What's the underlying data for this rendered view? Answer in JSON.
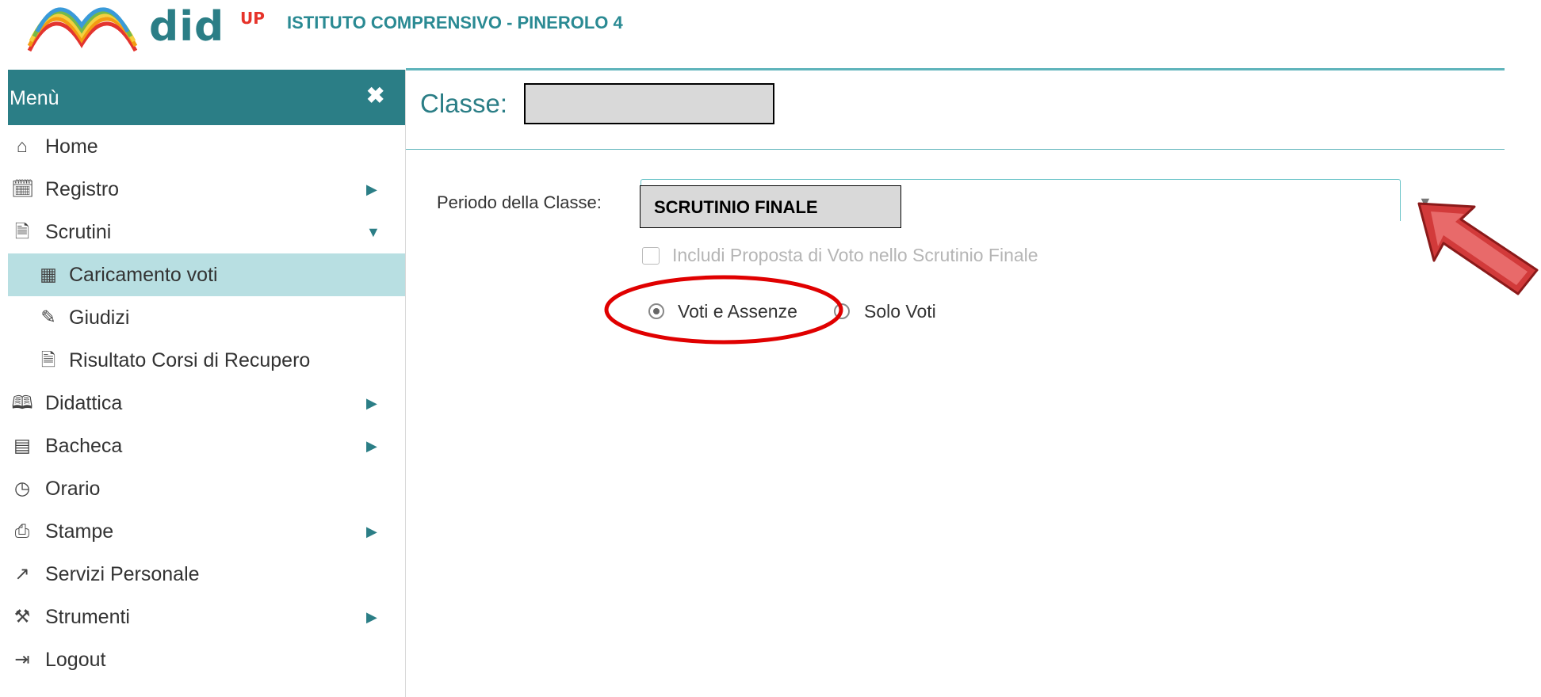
{
  "header": {
    "brand": "did",
    "brand_sup": "UP",
    "school": "ISTITUTO COMPRENSIVO - PINEROLO 4"
  },
  "sidebar": {
    "title": "Menù",
    "close_icon": "close-icon",
    "items": [
      {
        "label": "Home",
        "icon": "home-icon"
      },
      {
        "label": "Registro",
        "icon": "calendar-check-icon",
        "arrow": "▶"
      },
      {
        "label": "Scrutini",
        "icon": "document-icon",
        "arrow": "▼"
      },
      {
        "label": "Caricamento voti",
        "icon": "qrcode-icon",
        "active": true
      },
      {
        "label": "Giudizi",
        "icon": "edit-icon"
      },
      {
        "label": "Risultato Corsi di Recupero",
        "icon": "document-icon"
      },
      {
        "label": "Didattica",
        "icon": "book-icon",
        "arrow": "▶"
      },
      {
        "label": "Bacheca",
        "icon": "bulletin-icon",
        "arrow": "▶"
      },
      {
        "label": "Orario",
        "icon": "clock-icon"
      },
      {
        "label": "Stampe",
        "icon": "printer-icon",
        "arrow": "▶"
      },
      {
        "label": "Servizi Personale",
        "icon": "share-icon"
      },
      {
        "label": "Strumenti",
        "icon": "tools-icon",
        "arrow": "▶"
      },
      {
        "label": "Logout",
        "icon": "logout-icon"
      }
    ]
  },
  "main": {
    "class_label": "Classe:",
    "class_value": "",
    "periodo_label": "Periodo della Classe:",
    "periodo_value": "SCRUTINIO FINALE",
    "checkbox_label": "Includi Proposta di Voto nello Scrutinio Finale",
    "radio_options": [
      {
        "label": "Voti e Assenze",
        "selected": true
      },
      {
        "label": "Solo Voti",
        "selected": false
      }
    ]
  },
  "colors": {
    "accent": "#2b7e86",
    "active_bg": "#b8dfe2",
    "annotation_red": "#e00000"
  }
}
